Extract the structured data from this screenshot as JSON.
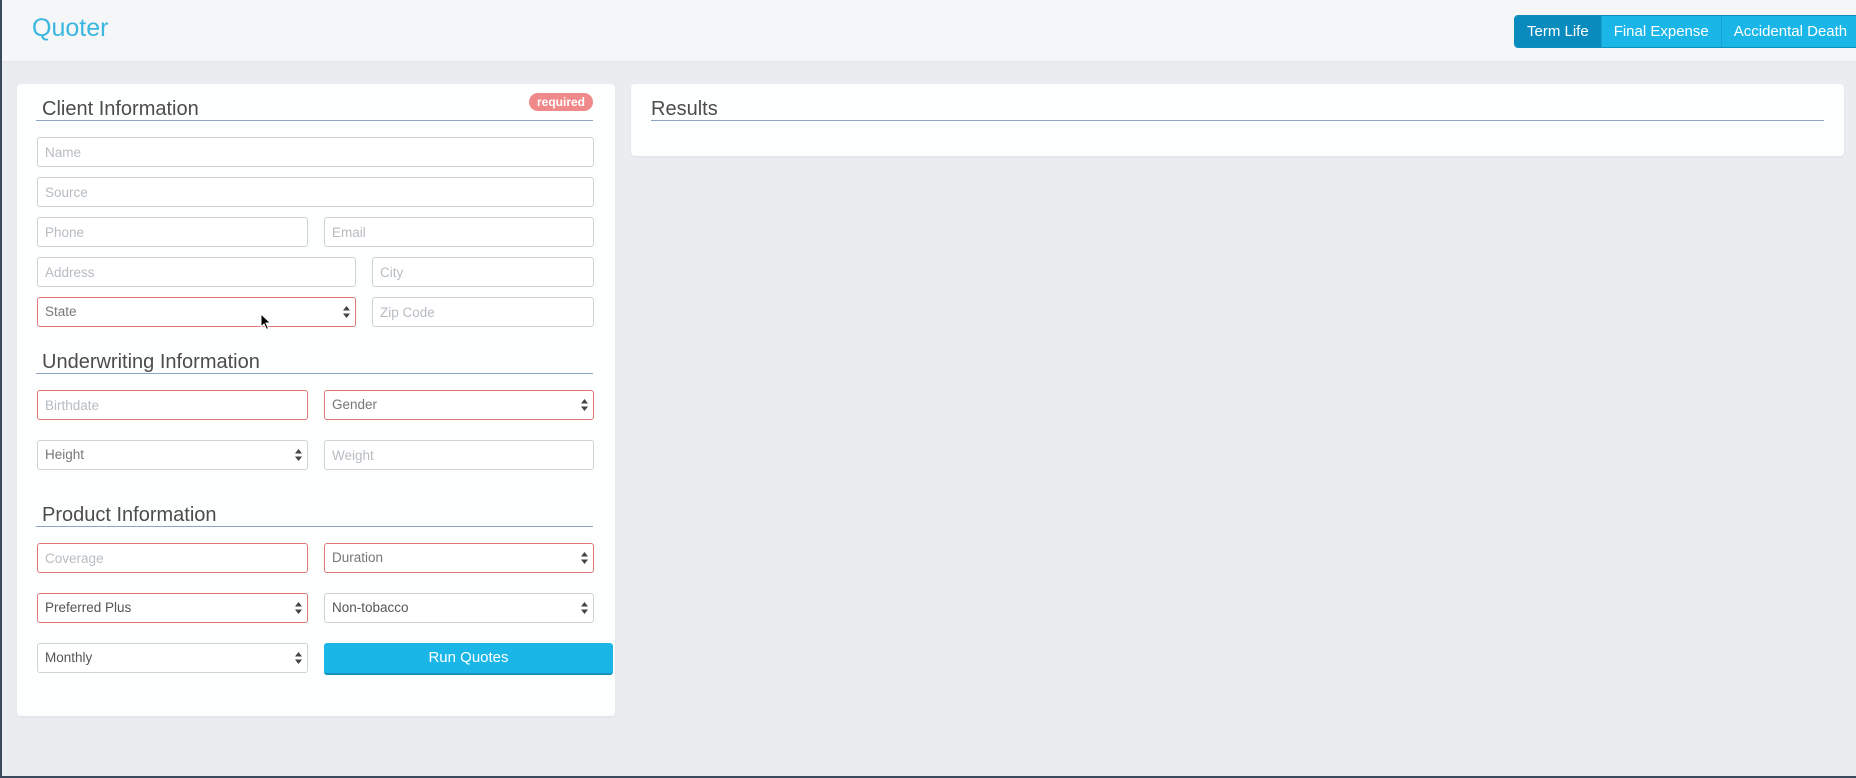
{
  "app": {
    "title": "Quoter"
  },
  "nav": {
    "tabs": [
      {
        "label": "Term Life",
        "active": true
      },
      {
        "label": "Final Expense",
        "active": false
      },
      {
        "label": "Accidental Death",
        "active": false
      }
    ]
  },
  "client": {
    "title": "Client Information",
    "badge": "required",
    "name_placeholder": "Name",
    "source_placeholder": "Source",
    "phone_placeholder": "Phone",
    "email_placeholder": "Email",
    "address_placeholder": "Address",
    "city_placeholder": "City",
    "state_value": "State",
    "zip_placeholder": "Zip Code"
  },
  "underwriting": {
    "title": "Underwriting Information",
    "birthdate_placeholder": "Birthdate",
    "gender_value": "Gender",
    "height_value": "Height",
    "weight_placeholder": "Weight"
  },
  "product": {
    "title": "Product Information",
    "coverage_placeholder": "Coverage",
    "duration_value": "Duration",
    "health_class_value": "Preferred Plus",
    "tobacco_value": "Non-tobacco",
    "frequency_value": "Monthly",
    "run_button": "Run Quotes"
  },
  "results": {
    "title": "Results"
  },
  "colors": {
    "accent": "#1ab6e8",
    "accent_active": "#0a8bbd",
    "brand": "#3bb7df",
    "required_border": "#e07676",
    "badge": "#f08a8a",
    "background": "#e9edf0"
  },
  "icons": {
    "select_arrows": "select-arrows-icon",
    "cursor": "mouse-cursor-icon"
  }
}
